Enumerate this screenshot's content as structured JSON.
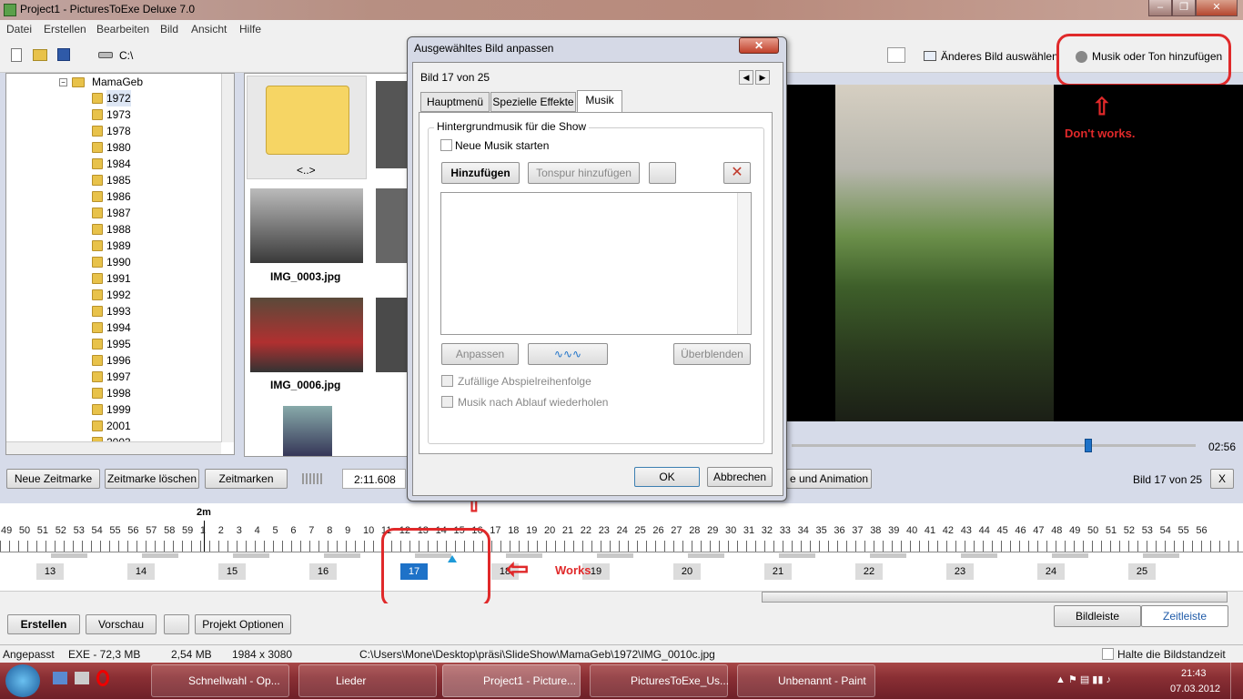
{
  "window": {
    "title": "Project1 - PicturesToExe Deluxe 7.0"
  },
  "menu": [
    "Datei",
    "Erstellen",
    "Bearbeiten",
    "Bild",
    "Ansicht",
    "Hilfe"
  ],
  "toolbar": {
    "path": "C:\\",
    "change_image": "Änderes Bild auswählen",
    "add_music": "Musik oder Ton hinzufügen"
  },
  "tree": {
    "root": "MamaGeb",
    "years": [
      "1972",
      "1973",
      "1978",
      "1980",
      "1984",
      "1985",
      "1986",
      "1987",
      "1988",
      "1989",
      "1990",
      "1991",
      "1992",
      "1993",
      "1994",
      "1995",
      "1996",
      "1997",
      "1998",
      "1999",
      "2001",
      "2003"
    ]
  },
  "thumbs": {
    "up": "<..>",
    "items": [
      "IMG_0003.jpg",
      "IMG_0006.jpg"
    ]
  },
  "preview": {
    "time": "02:56"
  },
  "controls": {
    "new_mark": "Neue Zeitmarke",
    "del_mark": "Zeitmarke löschen",
    "marks": "Zeitmarken",
    "time": "2:11.608",
    "animation": "e und Animation",
    "slide_of": "Bild 17 von 25",
    "close": "X"
  },
  "timeline": {
    "minute_label": "2m",
    "ticks": [
      "49",
      "50",
      "51",
      "52",
      "53",
      "54",
      "55",
      "56",
      "57",
      "58",
      "59",
      "1",
      "2",
      "3",
      "4",
      "5",
      "6",
      "7",
      "8",
      "9",
      "10",
      "11",
      "12",
      "13",
      "14",
      "15",
      "16",
      "17",
      "18",
      "19",
      "20",
      "21",
      "22",
      "23",
      "24",
      "25",
      "26",
      "27",
      "28",
      "29",
      "30",
      "31",
      "32",
      "33",
      "34",
      "35",
      "36",
      "37",
      "38",
      "39",
      "40",
      "41",
      "42",
      "43",
      "44",
      "45",
      "46",
      "47",
      "48",
      "49",
      "50",
      "51",
      "52",
      "53",
      "54",
      "55",
      "56"
    ],
    "slides": [
      "13",
      "14",
      "15",
      "16",
      "17",
      "18",
      "19",
      "20",
      "21",
      "22",
      "23",
      "24",
      "25"
    ]
  },
  "bottom": {
    "create": "Erstellen",
    "preview": "Vorschau",
    "project_options": "Projekt Optionen",
    "slides_tab": "Bildleiste",
    "timeline_tab": "Zeitleiste"
  },
  "status": {
    "mode": "Angepasst",
    "exe": "EXE - 72,3 MB",
    "size": "2,54 MB",
    "dims": "1984 x 3080",
    "path": "C:\\Users\\Mone\\Desktop\\präsi\\SlideShow\\MamaGeb\\1972\\IMG_0010c.jpg",
    "hold": "Halte die Bildstandzeit"
  },
  "dialog": {
    "title": "Ausgewähltes Bild anpassen",
    "slide": "Bild 17 von 25",
    "tabs": [
      "Hauptmenü",
      "Spezielle Effekte",
      "Musik"
    ],
    "group": "Hintergrundmusik für die Show",
    "new_music": "Neue Musik starten",
    "add": "Hinzufügen",
    "add_track": "Tonspur hinzufügen",
    "adjust": "Anpassen",
    "crossfade": "Überblenden",
    "random": "Zufällige Abspielreihenfolge",
    "repeat": "Musik nach Ablauf wiederholen",
    "ok": "OK",
    "cancel": "Abbrechen"
  },
  "annotations": {
    "dont_work": "Don't works.",
    "works": "Works"
  },
  "taskbar": {
    "items": [
      "Schnellwahl - Op...",
      "Lieder",
      "Project1 - Picture...",
      "PicturesToExe_Us...",
      "Unbenannt - Paint"
    ],
    "time": "21:43",
    "date": "07.03.2012"
  },
  "colors": {
    "accent": "#1e72c8",
    "annotation": "#e0292a"
  }
}
